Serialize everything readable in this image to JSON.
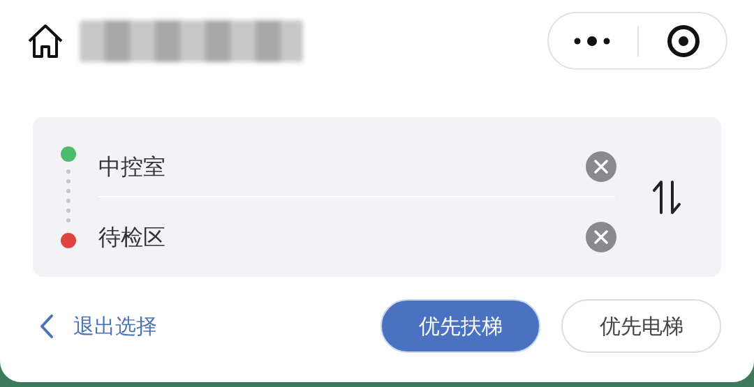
{
  "route": [
    {
      "name": "中控室",
      "color": "#4cbb6c"
    },
    {
      "name": "待检区",
      "color": "#e0443e"
    }
  ],
  "back_link": "退出选择",
  "options": [
    {
      "label": "优先扶梯",
      "selected": true
    },
    {
      "label": "优先电梯",
      "selected": false
    }
  ]
}
